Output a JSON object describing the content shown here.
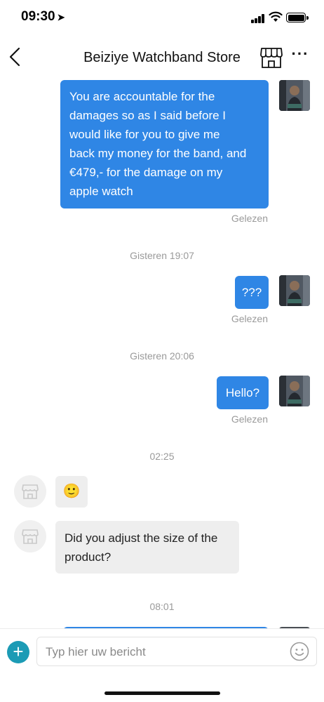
{
  "status_bar": {
    "time": "09:30",
    "location_icon": "location-arrow-icon"
  },
  "nav": {
    "title": "Beiziye Watchband Store",
    "back_icon": "chevron-left-icon",
    "store_icon": "store-icon",
    "more_icon": "more-icon",
    "more_label": "···"
  },
  "messages": [
    {
      "side": "right",
      "lines": [
        "You are accountable for the",
        "damages so as I said before I",
        "would like for you to give me",
        "back my money for the band, and",
        "€479,- for the damage on my",
        "apple watch"
      ],
      "status": "Gelezen"
    },
    {
      "type": "time",
      "label": "Gisteren 19:07"
    },
    {
      "side": "right",
      "text": "???",
      "status": "Gelezen"
    },
    {
      "type": "time",
      "label": "Gisteren 20:06"
    },
    {
      "side": "right",
      "text": "Hello?",
      "status": "Gelezen"
    },
    {
      "type": "time",
      "label": "02:25"
    },
    {
      "side": "left",
      "emoji": "🙂"
    },
    {
      "side": "left",
      "lines": [
        "Did you adjust the size of the",
        "product?"
      ]
    },
    {
      "type": "time",
      "label": "08:01"
    }
  ],
  "input": {
    "placeholder": "Typ hier uw bericht",
    "plus_label": "+",
    "emoji_icon": "smiley-icon"
  },
  "colors": {
    "bubble_self": "#2f86e5",
    "bubble_store": "#eeeeee",
    "plus_button": "#1c9bb5"
  }
}
